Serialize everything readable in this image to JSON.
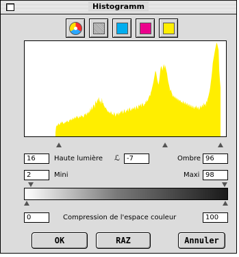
{
  "window": {
    "title": "Histogramm"
  },
  "channels": [
    {
      "name": "rgb-icon",
      "color": ""
    },
    {
      "name": "gray-icon",
      "color": "#b0b0b0"
    },
    {
      "name": "cyan-icon",
      "color": "#00aeef"
    },
    {
      "name": "magenta-icon",
      "color": "#ec008c"
    },
    {
      "name": "yellow-icon",
      "color": "#ffee00"
    }
  ],
  "histogram": {
    "fill_color": "#ffee00",
    "levels": [
      4,
      10,
      12,
      11,
      13,
      14,
      12,
      13,
      15,
      14,
      16,
      15,
      14,
      13,
      15,
      14,
      16,
      15,
      17,
      16,
      15,
      16,
      18,
      17,
      19,
      17,
      18,
      20,
      18,
      19,
      21,
      19,
      20,
      22,
      21,
      20,
      19,
      22,
      20,
      21,
      23,
      21,
      22,
      20,
      21,
      24,
      23,
      25,
      22,
      24,
      26,
      24,
      27,
      25,
      30,
      27,
      32,
      28,
      31,
      34,
      33,
      30,
      38,
      36,
      35,
      40,
      37,
      42,
      39,
      36,
      38,
      34,
      41,
      35,
      36,
      33,
      32,
      30,
      31,
      29,
      28,
      26,
      27,
      25,
      26,
      24,
      27,
      25,
      23,
      24,
      22,
      26,
      24,
      21,
      23,
      25,
      23,
      26,
      22,
      25,
      24,
      27,
      25,
      28,
      26,
      24,
      27,
      29,
      26,
      25,
      28,
      27,
      30,
      26,
      29,
      31,
      28,
      27,
      30,
      28,
      31,
      29,
      30,
      32,
      28,
      31,
      33,
      30,
      29,
      34,
      32,
      33,
      35,
      31,
      34,
      36,
      33,
      32,
      35,
      34,
      38,
      36,
      39,
      37,
      40,
      42,
      44,
      43,
      47,
      49,
      52,
      55,
      58,
      62,
      66,
      70,
      68,
      64,
      60,
      57,
      55,
      60,
      66,
      72,
      75,
      73,
      70,
      74,
      77,
      72,
      76,
      73,
      70,
      67,
      62,
      58,
      55,
      52,
      48,
      50,
      47,
      45,
      42,
      44,
      41,
      43,
      40,
      42,
      39,
      41,
      38,
      40,
      37,
      39,
      38,
      36,
      37,
      35,
      38,
      36,
      34,
      37,
      35,
      33,
      36,
      34,
      32,
      35,
      33,
      31,
      34,
      32,
      30,
      33,
      31,
      29,
      32,
      30,
      33,
      31,
      29,
      32,
      30,
      28,
      31,
      33,
      30,
      32,
      34,
      31,
      36,
      33,
      35,
      32,
      38,
      36,
      40,
      42,
      45,
      48,
      52,
      58,
      63,
      70,
      78,
      82,
      86,
      90,
      94,
      97,
      100,
      98,
      95,
      92,
      70,
      60,
      52
    ],
    "markers": {
      "low": 16,
      "mid": 70,
      "high": 96
    }
  },
  "controls": {
    "highlight_value": "16",
    "highlight_label": "Haute lumière",
    "gamma_value": "-7",
    "shadow_label": "Ombre",
    "shadow_value": "96",
    "mini_value": "2",
    "mini_label": "Mini",
    "maxi_label": "Maxi",
    "maxi_value": "98",
    "compression_label": "Compression de l'espace couleur",
    "compression_min": "0",
    "compression_max": "100"
  },
  "buttons": {
    "ok": "OK",
    "raz": "RAZ",
    "cancel": "Annuler"
  }
}
